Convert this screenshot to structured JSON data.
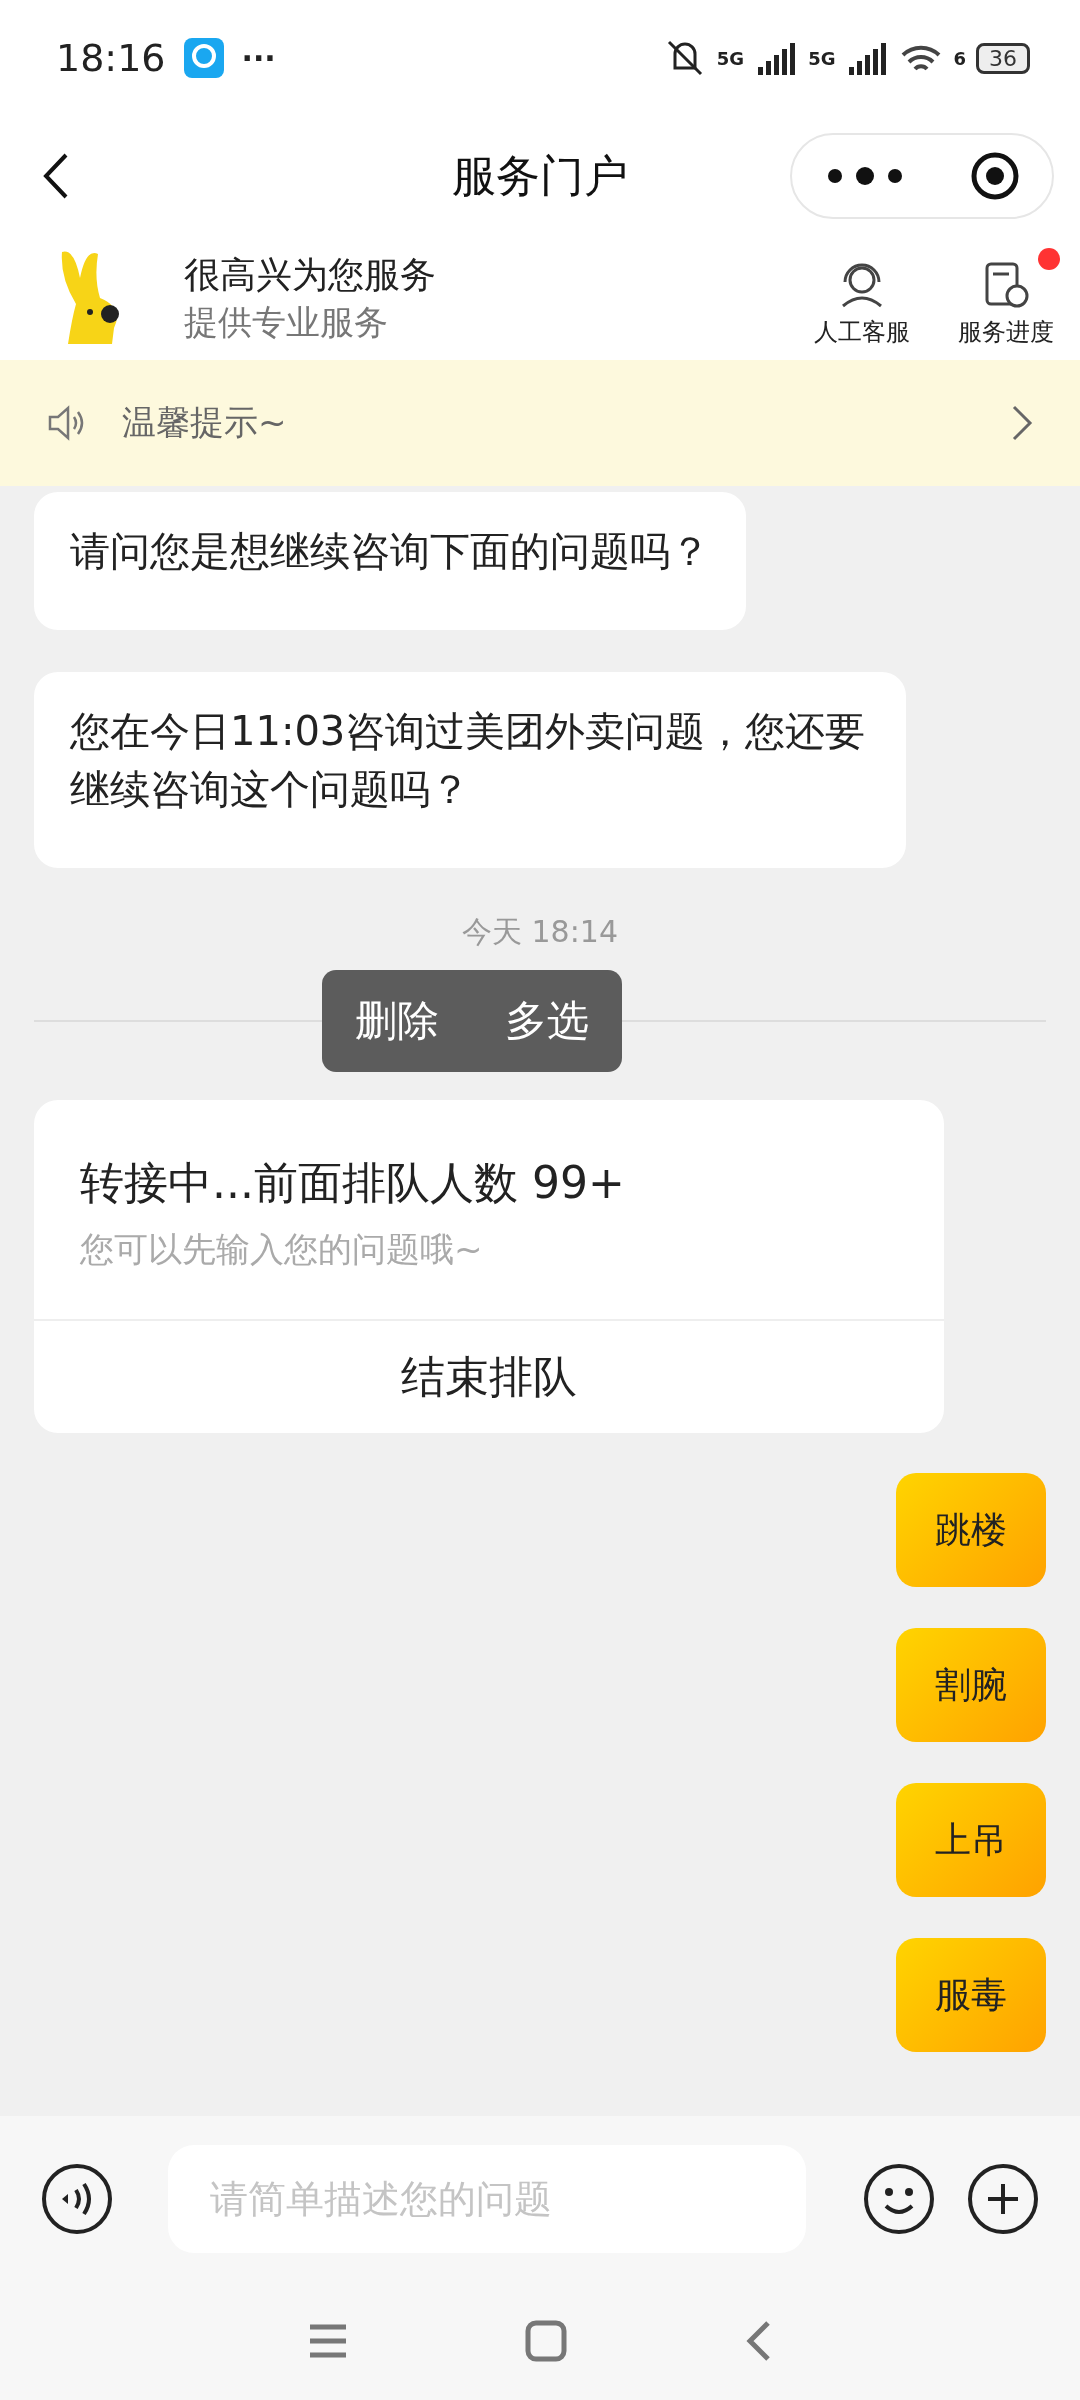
{
  "status_bar": {
    "time": "18:16",
    "more": "···",
    "signal_label_1": "5G",
    "signal_label_2": "5G",
    "wifi_label": "6",
    "battery": "36"
  },
  "nav": {
    "title": "服务门户"
  },
  "header": {
    "title": "很高兴为您服务",
    "subtitle": "提供专业服务",
    "actions": [
      {
        "label": "人工客服",
        "kind": "agent",
        "badge": false
      },
      {
        "label": "服务进度",
        "kind": "progress",
        "badge": true
      }
    ]
  },
  "notice": {
    "text": "温馨提示~"
  },
  "messages": [
    {
      "text": "请问您是想继续咨询下面的问题吗？"
    },
    {
      "text": "您在今日11:03咨询过美团外卖问题，您还要继续咨询这个问题吗？"
    }
  ],
  "timestamp": "今天 18:14",
  "context_menu": [
    "删除",
    "多选"
  ],
  "queue_card": {
    "title": "转接中...前面排队人数 99+",
    "hint": "您可以先输入您的问题哦~",
    "button": "结束排队"
  },
  "sent_messages": [
    {
      "text": "跳楼"
    },
    {
      "text": "割腕"
    },
    {
      "text": "上吊"
    },
    {
      "text": "服毒"
    }
  ],
  "input": {
    "placeholder": "请简单描述您的问题"
  }
}
